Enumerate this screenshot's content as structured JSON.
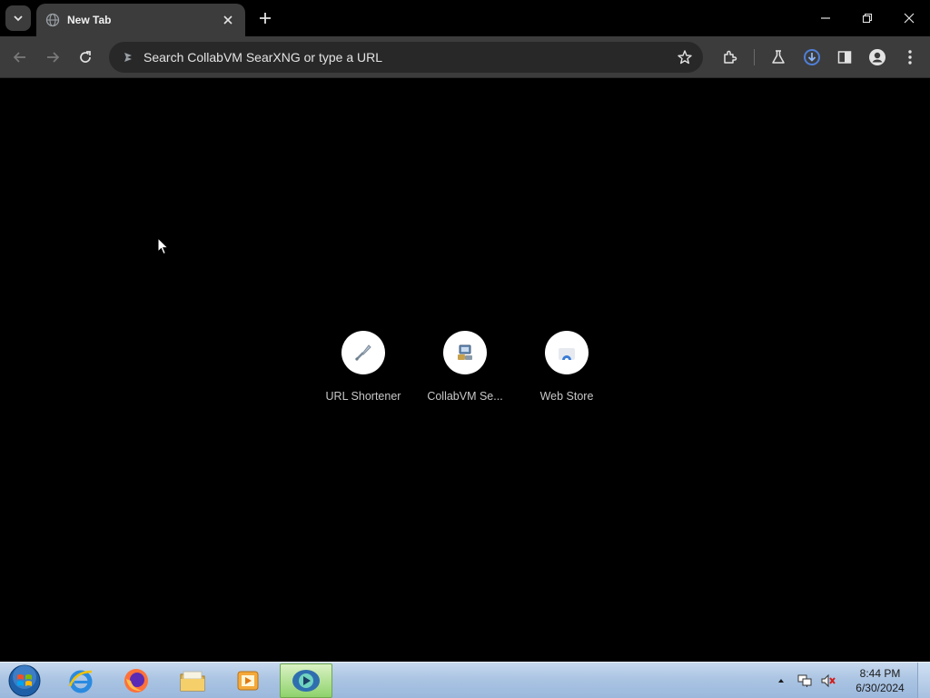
{
  "browser": {
    "tab": {
      "title": "New Tab",
      "favicon": "globe-icon"
    },
    "new_tab_symbol": "+",
    "omnibox": {
      "placeholder": "Search CollabVM SearXNG or type a URL",
      "value": ""
    },
    "toolbar_icons": [
      "back-icon",
      "forward-icon",
      "reload-icon",
      "bookmark-star-icon",
      "extensions-icon",
      "labs-icon",
      "download-icon",
      "side-panel-icon",
      "profile-icon",
      "menu-icon"
    ]
  },
  "new_tab_page": {
    "shortcuts": [
      {
        "label": "URL Shortener",
        "icon": "link-icon"
      },
      {
        "label": "CollabVM Se...",
        "icon": "collabvm-icon"
      },
      {
        "label": "Web Store",
        "icon": "web-store-icon"
      }
    ]
  },
  "taskbar": {
    "pinned": [
      "internet-explorer-icon",
      "firefox-icon",
      "file-explorer-icon",
      "media-player-icon",
      "chrome-app-icon"
    ],
    "clock": {
      "time": "8:44 PM",
      "date": "6/30/2024"
    }
  },
  "colors": {
    "background": "#000000",
    "toolbar": "#3c3c3c",
    "omnibox": "#282828",
    "download_accent": "#8ab4f8",
    "taskbar": "#a9c3e2"
  }
}
